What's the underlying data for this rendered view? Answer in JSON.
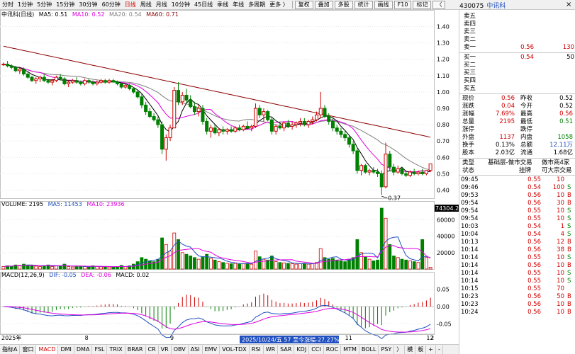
{
  "toolbar": {
    "periods": [
      "分时",
      "1分钟",
      "5分钟",
      "15分钟",
      "30分钟",
      "60分钟",
      "日线",
      "周线",
      "月线",
      "10分钟",
      "45日线",
      "季线",
      "年线",
      "多周期",
      "更多 〉"
    ],
    "active_period": "日线",
    "tools": [
      "复权",
      "叠加",
      "多股",
      "统计",
      "画线",
      "F10",
      "标记",
      "〈"
    ]
  },
  "panel_header": {
    "code": "430075",
    "name": "中讯科",
    "close": "×"
  },
  "price_legend": {
    "title": "中讯科(日线)",
    "ma5": "MA5: 0.51",
    "ma10": "MA10: 0.52",
    "ma20": "MA20: 0.54",
    "ma60": "MA60: 0.71"
  },
  "volume_legend": {
    "title": "VOLUME: 2195",
    "ma5": "MA5: 11453",
    "ma10": "MA10: 23936"
  },
  "macd_legend": {
    "title": "MACD(12,26,9)",
    "dif": "DIF: -0.05",
    "dea": "DEA: -0.06",
    "macd": "MACD: 0.02"
  },
  "axis": {
    "price_ticks": [
      "1.40",
      "1.30",
      "1.20",
      "1.10",
      "1.00",
      "0.90",
      "0.80",
      "0.70",
      "0.60",
      "0.50",
      "0.40"
    ],
    "volume_ticks": [
      "60000",
      "40000",
      "20000"
    ],
    "volume_max_label": "74304.24",
    "macd_ticks": [
      "0.05",
      "0.00",
      "-0.05"
    ],
    "date_labels": [
      "2025年",
      "8",
      "9",
      "10",
      "11",
      "12",
      "2"
    ],
    "low_marker": "0.37",
    "cursor_info": "2025/10/24/五 57 至今涨幅-27.27%"
  },
  "colors": {
    "up": "#d00000",
    "down": "#008000",
    "ma5": "#000000",
    "ma10": "#e000e0",
    "ma20": "#808080",
    "ma60": "#8b0000",
    "dif": "#2050c0",
    "dea": "#e000e0"
  },
  "order_book": {
    "asks": [
      {
        "label": "卖五",
        "price": "",
        "vol": ""
      },
      {
        "label": "卖四",
        "price": "",
        "vol": ""
      },
      {
        "label": "卖三",
        "price": "",
        "vol": ""
      },
      {
        "label": "卖二",
        "price": "",
        "vol": ""
      },
      {
        "label": "卖一",
        "price": "0.56",
        "vol": "130"
      }
    ],
    "bids": [
      {
        "label": "买一",
        "price": "0.54",
        "vol": "50"
      },
      {
        "label": "买二",
        "price": "",
        "vol": ""
      },
      {
        "label": "买三",
        "price": "",
        "vol": ""
      },
      {
        "label": "买四",
        "price": "",
        "vol": ""
      },
      {
        "label": "买五",
        "price": "",
        "vol": ""
      }
    ]
  },
  "stats": [
    [
      {
        "l": "现价",
        "v": "0.56",
        "c": "r"
      },
      {
        "l": "昨收",
        "v": "0.52",
        "c": ""
      }
    ],
    [
      {
        "l": "涨跌",
        "v": "0.04",
        "c": "r"
      },
      {
        "l": "今开",
        "v": "0.52",
        "c": ""
      }
    ],
    [
      {
        "l": "涨幅",
        "v": "7.69%",
        "c": "r"
      },
      {
        "l": "最高",
        "v": "0.56",
        "c": "r"
      }
    ],
    [
      {
        "l": "总量",
        "v": "2195",
        "c": "r"
      },
      {
        "l": "最低",
        "v": "0.51",
        "c": "g"
      }
    ],
    [
      {
        "l": "涨停",
        "v": "",
        "c": ""
      },
      {
        "l": "跌停",
        "v": "",
        "c": ""
      }
    ],
    [
      {
        "l": "外盘",
        "v": "1137",
        "c": "r"
      },
      {
        "l": "内盘",
        "v": "1058",
        "c": "g"
      }
    ],
    [
      {
        "l": "换手",
        "v": "0.13%",
        "c": ""
      },
      {
        "l": "总额",
        "v": "12.11万",
        "c": "b"
      }
    ],
    [
      {
        "l": "股本",
        "v": "2.03亿",
        "c": ""
      },
      {
        "l": "流通",
        "v": "1.68亿",
        "c": ""
      }
    ]
  ],
  "info": {
    "type_label": "类型",
    "type_value": "基础层-做市交易",
    "mm_label": "做市商4家",
    "status_label": "状态",
    "status_value": "挂牌",
    "trade_value": "可大宗交易"
  },
  "ticks": [
    {
      "t": "09:45",
      "p": "0.55",
      "v": "10",
      "s": "",
      "c": "r"
    },
    {
      "t": "09:46",
      "p": "0.54",
      "v": "100",
      "s": "S",
      "c": "g"
    },
    {
      "t": "09:53",
      "p": "0.56",
      "v": "10",
      "s": "B",
      "c": "r"
    },
    {
      "t": "09:54",
      "p": "0.56",
      "v": "30",
      "s": "B",
      "c": "r"
    },
    {
      "t": "09:54",
      "p": "0.55",
      "v": "10",
      "s": "S",
      "c": "g"
    },
    {
      "t": "09:54",
      "p": "0.55",
      "v": "10",
      "s": "S",
      "c": "g"
    },
    {
      "t": "10:03",
      "p": "0.54",
      "v": "1",
      "s": "S",
      "c": "g"
    },
    {
      "t": "10:04",
      "p": "0.54",
      "v": "4",
      "s": "S",
      "c": "g"
    },
    {
      "t": "10:13",
      "p": "0.56",
      "v": "12",
      "s": "B",
      "c": "r"
    },
    {
      "t": "10:14",
      "p": "0.56",
      "v": "38",
      "s": "B",
      "c": "r"
    },
    {
      "t": "10:14",
      "p": "0.55",
      "v": "10",
      "s": "S",
      "c": "g"
    },
    {
      "t": "10:14",
      "p": "0.56",
      "v": "10",
      "s": "B",
      "c": "r"
    },
    {
      "t": "10:14",
      "p": "0.55",
      "v": "10",
      "s": "S",
      "c": "g"
    },
    {
      "t": "10:14",
      "p": "0.55",
      "v": "10",
      "s": "S",
      "c": "g"
    },
    {
      "t": "10:15",
      "p": "0.55",
      "v": "70",
      "s": "",
      "c": "r"
    },
    {
      "t": "10:23",
      "p": "0.56",
      "v": "50",
      "s": "B",
      "c": "r"
    },
    {
      "t": "10:23",
      "p": "0.56",
      "v": "10",
      "s": "B",
      "c": "r"
    },
    {
      "t": "10:24",
      "p": "0.56",
      "v": "10",
      "s": "B",
      "c": "r"
    }
  ],
  "bottom_tabs": [
    "指标A",
    "窗口",
    "MACD",
    "DMI",
    "DMA",
    "FSL",
    "TRIX",
    "BRAR",
    "CR",
    "VR",
    "OBV",
    "ASI",
    "EMV",
    "VOL-TDX",
    "RSI",
    "WR",
    "SAR",
    "KDJ",
    "CCI",
    "ROC",
    "MTM",
    "BOLL",
    "PSY",
    "〉",
    "模",
    "板",
    "+",
    "-"
  ],
  "active_tab": "MACD",
  "chart_data": {
    "type": "candlestick",
    "title": "中讯科(日线)",
    "price_ylim": [
      0.35,
      1.45
    ],
    "volume_ylim": [
      0,
      74304.24
    ],
    "macd_ylim": [
      -0.08,
      0.08
    ],
    "candles": [
      [
        1.17,
        1.18,
        1.16,
        1.17,
        3000
      ],
      [
        1.17,
        1.19,
        1.15,
        1.16,
        4000
      ],
      [
        1.16,
        1.17,
        1.14,
        1.15,
        3500
      ],
      [
        1.15,
        1.16,
        1.12,
        1.13,
        5000
      ],
      [
        1.13,
        1.15,
        1.11,
        1.14,
        4500
      ],
      [
        1.14,
        1.15,
        1.1,
        1.11,
        6000
      ],
      [
        1.11,
        1.12,
        1.08,
        1.09,
        5000
      ],
      [
        1.09,
        1.1,
        1.06,
        1.07,
        4000
      ],
      [
        1.07,
        1.09,
        1.05,
        1.08,
        3500
      ],
      [
        1.08,
        1.1,
        1.06,
        1.09,
        3000
      ],
      [
        1.09,
        1.11,
        1.06,
        1.07,
        4000
      ],
      [
        1.07,
        1.08,
        1.05,
        1.06,
        5000
      ],
      [
        1.06,
        1.08,
        1.04,
        1.07,
        3000
      ],
      [
        1.07,
        1.1,
        1.06,
        1.09,
        4000
      ],
      [
        1.09,
        1.11,
        1.07,
        1.08,
        3500
      ],
      [
        1.08,
        1.09,
        1.04,
        1.05,
        6000
      ],
      [
        1.05,
        1.07,
        1.03,
        1.06,
        3000
      ],
      [
        1.06,
        1.08,
        1.05,
        1.07,
        2500
      ],
      [
        1.07,
        1.09,
        1.05,
        1.06,
        3000
      ],
      [
        1.06,
        1.07,
        1.04,
        1.05,
        3500
      ],
      [
        1.05,
        1.08,
        1.04,
        1.07,
        3000
      ],
      [
        1.07,
        1.08,
        1.05,
        1.06,
        2500
      ],
      [
        1.06,
        1.07,
        1.04,
        1.05,
        4000
      ],
      [
        1.05,
        1.07,
        1.04,
        1.06,
        3000
      ],
      [
        1.06,
        1.08,
        1.05,
        1.07,
        2800
      ],
      [
        1.07,
        1.08,
        1.05,
        1.06,
        3200
      ],
      [
        1.06,
        1.08,
        1.05,
        1.07,
        2500
      ],
      [
        1.07,
        1.08,
        1.06,
        1.06,
        2200
      ],
      [
        1.06,
        1.07,
        1.04,
        1.05,
        3000
      ],
      [
        1.05,
        1.06,
        1.02,
        1.03,
        4500
      ],
      [
        1.03,
        1.05,
        1.02,
        1.04,
        3000
      ],
      [
        1.04,
        1.05,
        1.01,
        1.02,
        4000
      ],
      [
        1.02,
        1.03,
        0.99,
        1.0,
        6000
      ],
      [
        1.0,
        1.01,
        0.96,
        0.97,
        9000
      ],
      [
        0.97,
        0.99,
        0.9,
        0.92,
        14000
      ],
      [
        0.92,
        0.94,
        0.86,
        0.88,
        12000
      ],
      [
        0.88,
        0.9,
        0.84,
        0.85,
        10000
      ],
      [
        0.85,
        0.87,
        0.82,
        0.83,
        9000
      ],
      [
        0.83,
        0.85,
        0.78,
        0.8,
        12000
      ],
      [
        0.8,
        0.82,
        0.62,
        0.65,
        38000
      ],
      [
        0.65,
        0.74,
        0.58,
        0.72,
        30000
      ],
      [
        0.72,
        0.8,
        0.7,
        0.78,
        22000
      ],
      [
        0.78,
        1.03,
        0.78,
        1.01,
        44000
      ],
      [
        1.01,
        1.06,
        0.92,
        0.94,
        36000
      ],
      [
        0.94,
        1.0,
        0.92,
        0.98,
        20000
      ],
      [
        0.98,
        1.02,
        0.93,
        0.95,
        18000
      ],
      [
        0.95,
        0.98,
        0.9,
        0.91,
        16000
      ],
      [
        0.91,
        0.94,
        0.86,
        0.88,
        14000
      ],
      [
        0.88,
        0.92,
        0.85,
        0.9,
        12000
      ],
      [
        0.9,
        0.92,
        0.8,
        0.82,
        15000
      ],
      [
        0.82,
        0.84,
        0.74,
        0.76,
        18000
      ],
      [
        0.76,
        0.8,
        0.72,
        0.78,
        13000
      ],
      [
        0.78,
        0.8,
        0.74,
        0.75,
        11000
      ],
      [
        0.75,
        0.78,
        0.73,
        0.77,
        9000
      ],
      [
        0.77,
        0.79,
        0.74,
        0.76,
        8000
      ],
      [
        0.76,
        0.78,
        0.74,
        0.77,
        7000
      ],
      [
        0.77,
        0.79,
        0.75,
        0.76,
        6500
      ],
      [
        0.76,
        0.79,
        0.75,
        0.78,
        7000
      ],
      [
        0.78,
        0.8,
        0.76,
        0.77,
        6000
      ],
      [
        0.77,
        0.8,
        0.76,
        0.79,
        6500
      ],
      [
        0.79,
        0.82,
        0.77,
        0.78,
        7000
      ],
      [
        0.78,
        0.8,
        0.76,
        0.79,
        6000
      ],
      [
        0.79,
        0.93,
        0.78,
        0.9,
        22000
      ],
      [
        0.9,
        0.92,
        0.84,
        0.86,
        15000
      ],
      [
        0.86,
        0.9,
        0.82,
        0.88,
        12000
      ],
      [
        0.88,
        0.89,
        0.82,
        0.83,
        11000
      ],
      [
        0.83,
        0.85,
        0.74,
        0.76,
        16000
      ],
      [
        0.76,
        0.8,
        0.74,
        0.79,
        9000
      ],
      [
        0.79,
        0.82,
        0.77,
        0.78,
        8000
      ],
      [
        0.78,
        0.82,
        0.76,
        0.81,
        7500
      ],
      [
        0.81,
        0.83,
        0.78,
        0.79,
        7000
      ],
      [
        0.79,
        0.82,
        0.77,
        0.8,
        6500
      ],
      [
        0.8,
        0.82,
        0.78,
        0.81,
        6000
      ],
      [
        0.81,
        0.84,
        0.79,
        0.82,
        6500
      ],
      [
        0.82,
        0.84,
        0.79,
        0.8,
        7000
      ],
      [
        0.8,
        0.83,
        0.78,
        0.82,
        6000
      ],
      [
        0.82,
        0.85,
        0.8,
        0.83,
        6500
      ],
      [
        0.83,
        0.88,
        0.82,
        0.86,
        8000
      ],
      [
        0.86,
        1.0,
        0.84,
        0.9,
        25000
      ],
      [
        0.9,
        0.92,
        0.84,
        0.85,
        14000
      ],
      [
        0.85,
        0.87,
        0.8,
        0.82,
        12000
      ],
      [
        0.82,
        0.84,
        0.76,
        0.78,
        13000
      ],
      [
        0.78,
        0.8,
        0.74,
        0.76,
        11000
      ],
      [
        0.76,
        0.78,
        0.72,
        0.74,
        10000
      ],
      [
        0.74,
        0.76,
        0.7,
        0.72,
        9000
      ],
      [
        0.72,
        0.74,
        0.66,
        0.68,
        12000
      ],
      [
        0.68,
        0.7,
        0.62,
        0.64,
        14000
      ],
      [
        0.64,
        0.66,
        0.5,
        0.52,
        36000
      ],
      [
        0.52,
        0.56,
        0.49,
        0.55,
        20000
      ],
      [
        0.55,
        0.56,
        0.5,
        0.51,
        15000
      ],
      [
        0.51,
        0.53,
        0.49,
        0.52,
        12000
      ],
      [
        0.52,
        0.54,
        0.5,
        0.51,
        10000
      ],
      [
        0.51,
        0.53,
        0.48,
        0.5,
        11000
      ],
      [
        0.5,
        0.52,
        0.37,
        0.42,
        74304
      ],
      [
        0.42,
        0.69,
        0.41,
        0.62,
        62000
      ],
      [
        0.62,
        0.64,
        0.52,
        0.54,
        30000
      ],
      [
        0.54,
        0.56,
        0.49,
        0.51,
        16000
      ],
      [
        0.51,
        0.55,
        0.5,
        0.53,
        14000
      ],
      [
        0.53,
        0.54,
        0.49,
        0.5,
        12000
      ],
      [
        0.5,
        0.52,
        0.48,
        0.49,
        11000
      ],
      [
        0.49,
        0.52,
        0.48,
        0.51,
        10000
      ],
      [
        0.51,
        0.53,
        0.49,
        0.5,
        9000
      ],
      [
        0.5,
        0.52,
        0.49,
        0.51,
        8000
      ],
      [
        0.51,
        0.53,
        0.49,
        0.5,
        36000
      ],
      [
        0.5,
        0.52,
        0.49,
        0.52,
        14000
      ],
      [
        0.52,
        0.56,
        0.51,
        0.56,
        2195
      ]
    ]
  }
}
